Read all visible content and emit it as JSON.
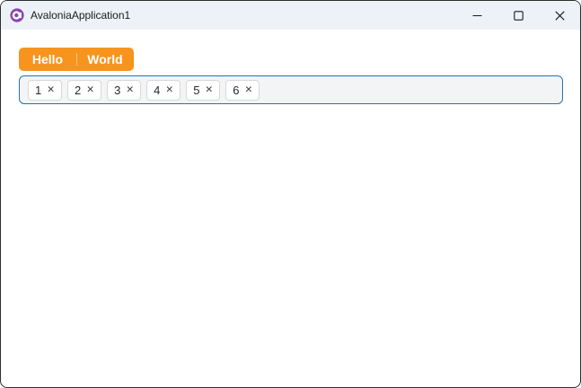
{
  "window": {
    "title": "AvaloniaApplication1"
  },
  "titlebar": {
    "controls": [
      "minimize",
      "maximize",
      "close"
    ]
  },
  "tabs": [
    {
      "label": "Hello"
    },
    {
      "label": "World"
    }
  ],
  "chip_input": {
    "remove_glyph": "✕",
    "chips": [
      {
        "label": "1"
      },
      {
        "label": "2"
      },
      {
        "label": "3"
      },
      {
        "label": "4"
      },
      {
        "label": "5"
      },
      {
        "label": "6"
      }
    ]
  },
  "icons": {
    "app": "avalonia-logo",
    "minimize": "minimize-icon",
    "maximize": "maximize-icon",
    "close": "close-icon",
    "chip_remove": "close-x"
  },
  "colors": {
    "accent": "#F7941E",
    "chipbox_border": "#2674A6",
    "chipbox_bg": "#F2F4F6",
    "titlebar_bg": "#EDF2F8",
    "window_border": "#2E2E2E"
  }
}
